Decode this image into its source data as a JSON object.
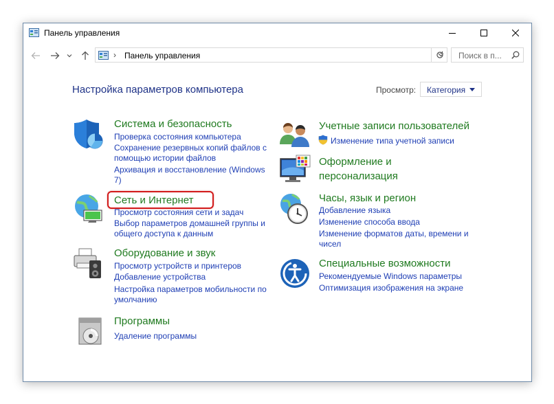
{
  "window": {
    "title": "Панель управления"
  },
  "address_bar": {
    "separator": "›",
    "path": "Панель управления",
    "search_placeholder": "Поиск в п..."
  },
  "main": {
    "heading": "Настройка параметров компьютера",
    "view_label": "Просмотр:",
    "view_value": "Категория"
  },
  "left_categories": [
    {
      "title": "Система и безопасность",
      "links": [
        "Проверка состояния компьютера",
        "Сохранение резервных копий файлов с",
        "помощью истории файлов",
        "Архивация и восстановление (Windows",
        "7)"
      ]
    },
    {
      "title": "Сеть и Интернет",
      "links": [
        "Просмотр состояния сети и задач",
        "Выбор параметров домашней группы и",
        "общего доступа к данным"
      ]
    },
    {
      "title": "Оборудование и звук",
      "links": [
        "Просмотр устройств и принтеров",
        "Добавление устройства",
        "Настройка параметров мобильности по",
        "умолчанию"
      ]
    },
    {
      "title": "Программы",
      "links": [
        "Удаление программы"
      ]
    }
  ],
  "right_categories": [
    {
      "title": "Учетные записи пользователей",
      "links": [
        "Изменение типа учетной записи"
      ]
    },
    {
      "title_lines": [
        "Оформление и",
        "персонализация"
      ]
    },
    {
      "title": "Часы, язык и регион",
      "links": [
        "Добавление языка",
        "Изменение способа ввода",
        "Изменение форматов даты, времени и",
        "чисел"
      ]
    },
    {
      "title": "Специальные возможности",
      "links": [
        "Рекомендуемые Windows параметры",
        "Оптимизация изображения на экране"
      ]
    }
  ],
  "colors": {
    "heading": "#1e3287",
    "category_title": "#1f7a1f",
    "link": "#1e3eb4",
    "highlight": "#d21a1a"
  }
}
